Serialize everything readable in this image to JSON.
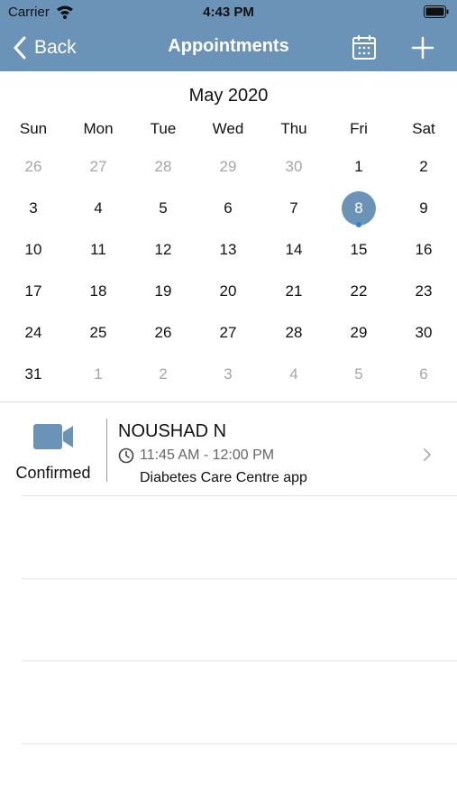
{
  "status_bar": {
    "carrier": "Carrier",
    "time": "4:43 PM"
  },
  "nav": {
    "back_label": "Back",
    "title": "Appointments"
  },
  "calendar": {
    "month_label": "May 2020",
    "weekdays": [
      "Sun",
      "Mon",
      "Tue",
      "Wed",
      "Thu",
      "Fri",
      "Sat"
    ],
    "selected_day": "8",
    "weeks": [
      [
        "26",
        "27",
        "28",
        "29",
        "30",
        "1",
        "2"
      ],
      [
        "3",
        "4",
        "5",
        "6",
        "7",
        "8",
        "9"
      ],
      [
        "10",
        "11",
        "12",
        "13",
        "14",
        "15",
        "16"
      ],
      [
        "17",
        "18",
        "19",
        "20",
        "21",
        "22",
        "23"
      ],
      [
        "24",
        "25",
        "26",
        "27",
        "28",
        "29",
        "30"
      ],
      [
        "31",
        "1",
        "2",
        "3",
        "4",
        "5",
        "6"
      ]
    ]
  },
  "appointment": {
    "status": "Confirmed",
    "patient_name": "NOUSHAD N",
    "time_range": "11:45 AM - 12:00 PM",
    "clinic": "Diabetes Care Centre app"
  },
  "colors": {
    "accent": "#6b93b8",
    "event_dot": "#2f7de1"
  }
}
